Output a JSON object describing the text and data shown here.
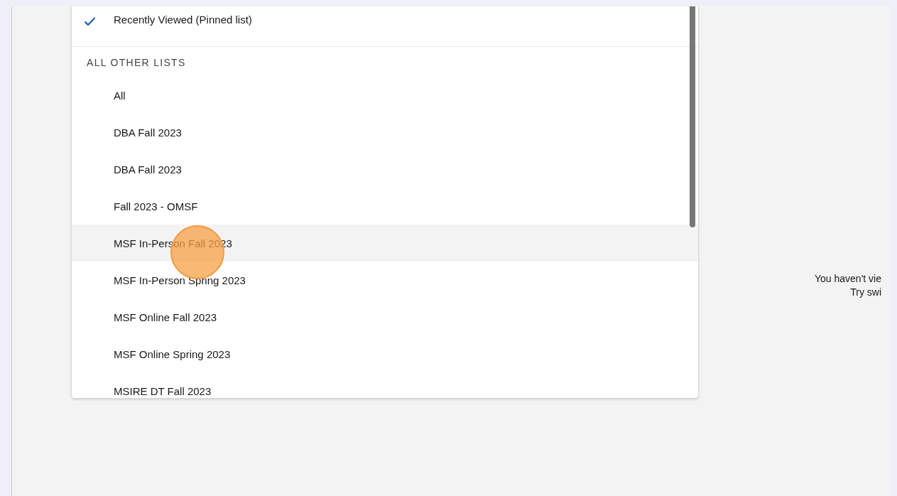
{
  "list_menu": {
    "pinned": [
      {
        "label": "Recently Viewed (Pinned list)",
        "checked": true
      }
    ],
    "section_header": "ALL OTHER LISTS",
    "items": [
      {
        "label": "All",
        "highlighted": false
      },
      {
        "label": "DBA Fall 2023",
        "highlighted": false
      },
      {
        "label": "DBA Fall 2023",
        "highlighted": false
      },
      {
        "label": "Fall 2023 - OMSF",
        "highlighted": false
      },
      {
        "label": "MSF In-Person Fall 2023",
        "highlighted": true
      },
      {
        "label": "MSF In-Person Spring 2023",
        "highlighted": false
      },
      {
        "label": "MSF Online Fall 2023",
        "highlighted": false
      },
      {
        "label": "MSF Online Spring 2023",
        "highlighted": false
      },
      {
        "label": "MSIRE DT Fall 2023",
        "highlighted": false
      }
    ]
  },
  "empty_state": {
    "lines": [
      "You haven't vie",
      "Try swi"
    ]
  }
}
